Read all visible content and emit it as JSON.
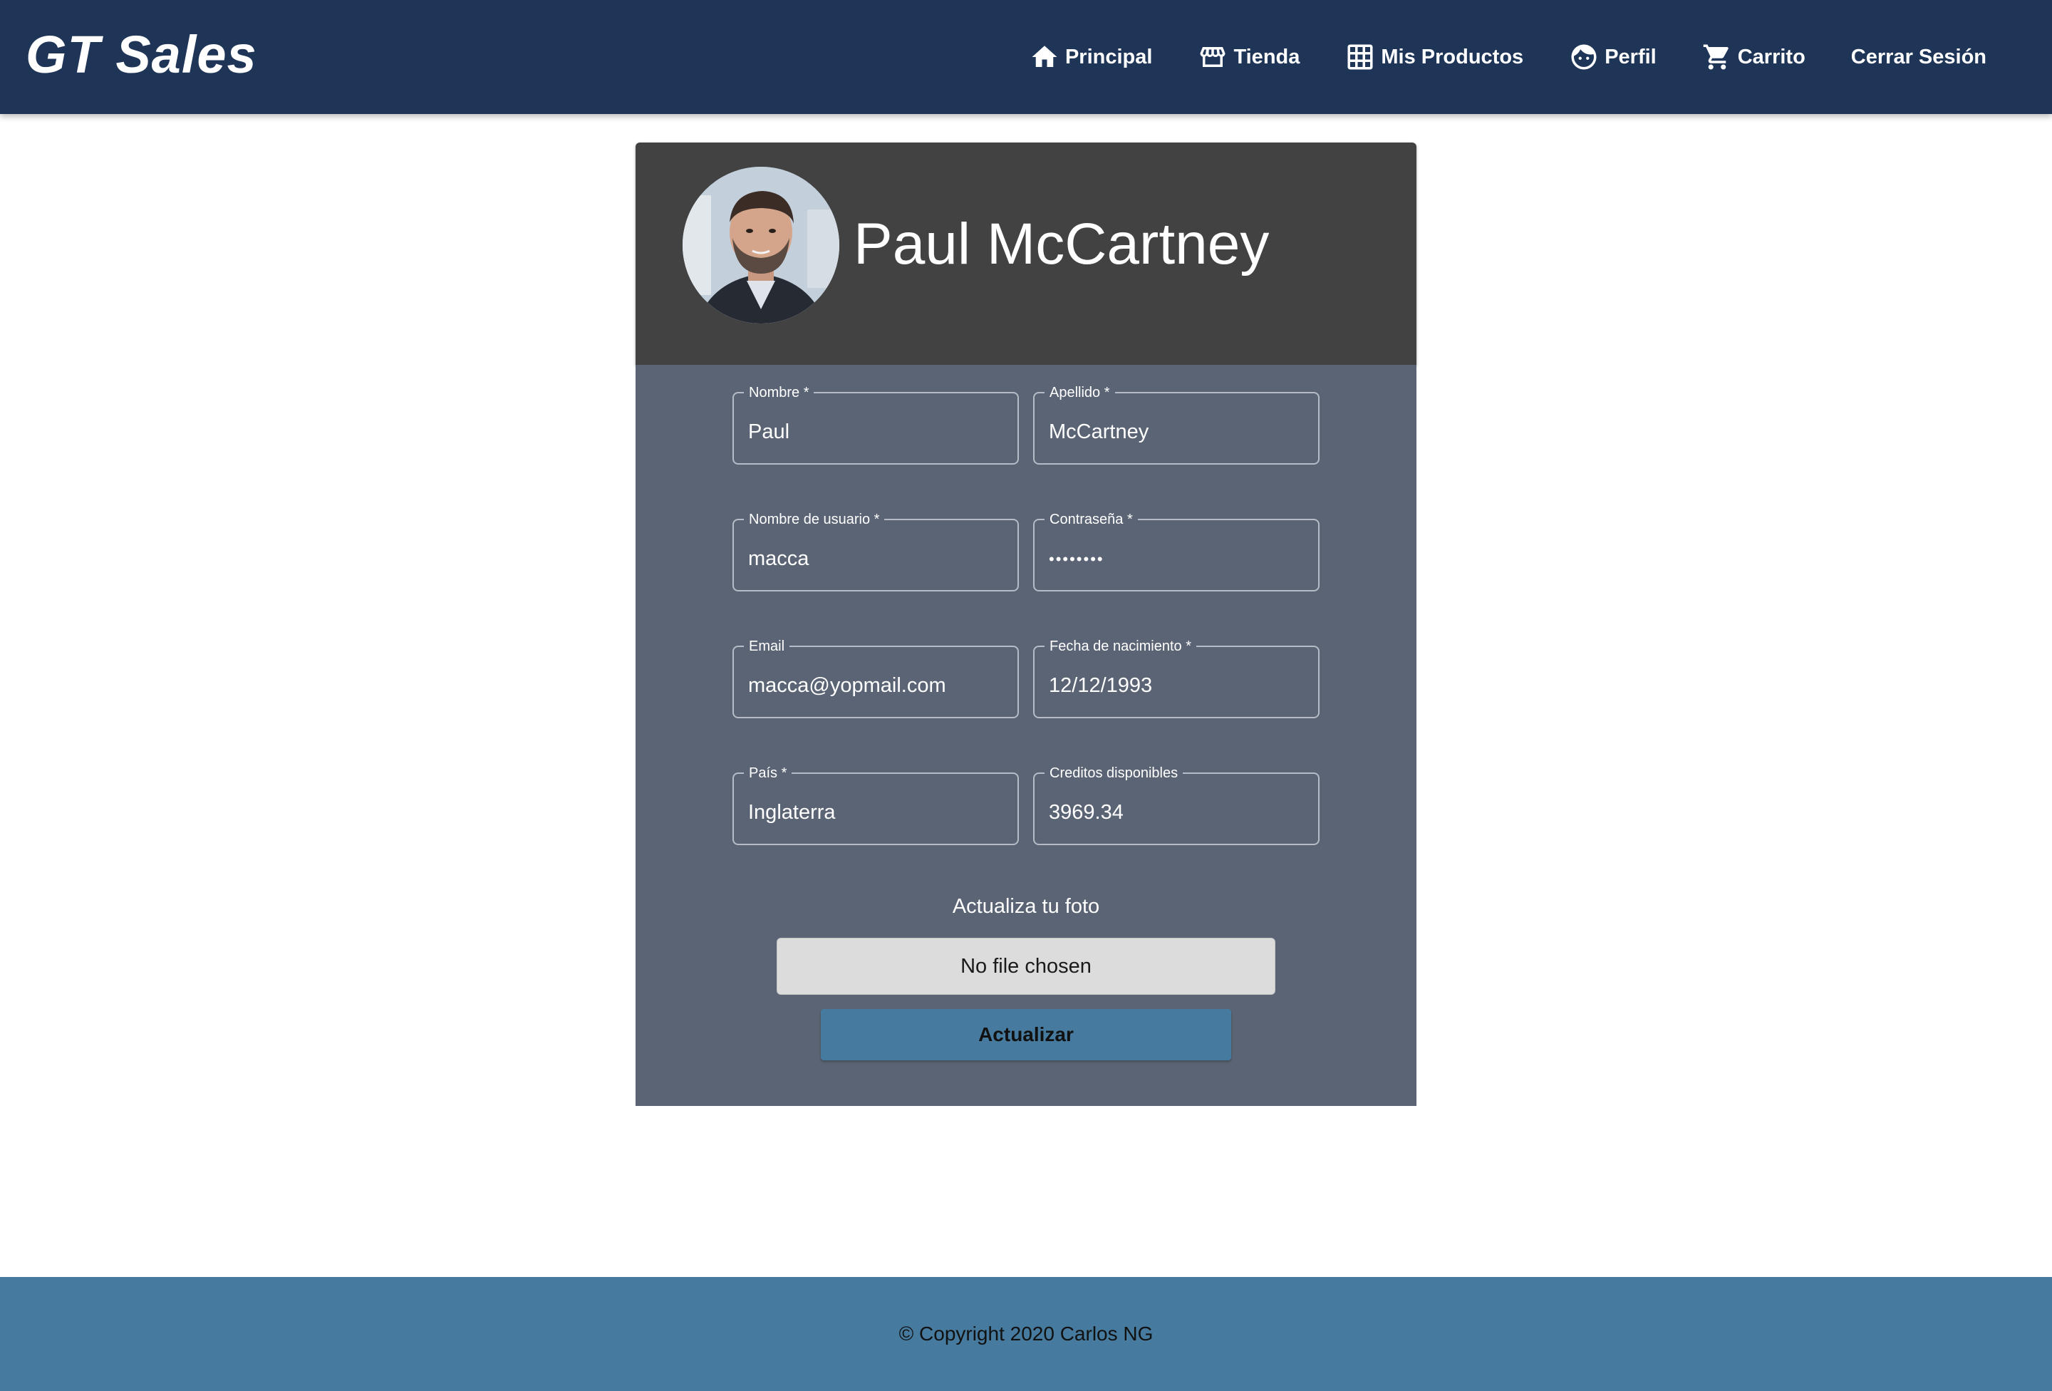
{
  "header": {
    "brand": "GT Sales",
    "nav": [
      {
        "label": "Principal",
        "icon": "home-icon"
      },
      {
        "label": "Tienda",
        "icon": "store-icon"
      },
      {
        "label": "Mis Productos",
        "icon": "grid-icon"
      },
      {
        "label": "Perfil",
        "icon": "face-icon"
      },
      {
        "label": "Carrito",
        "icon": "cart-icon"
      },
      {
        "label": "Cerrar Sesión",
        "icon": ""
      }
    ]
  },
  "profile": {
    "name": "Paul McCartney",
    "avatar_icon": "user-photo"
  },
  "form": {
    "nombre": {
      "label": "Nombre *",
      "value": "Paul"
    },
    "apellido": {
      "label": "Apellido *",
      "value": "McCartney"
    },
    "usuario": {
      "label": "Nombre de usuario *",
      "value": "macca"
    },
    "contrasena": {
      "label": "Contraseña *",
      "value": "••••••••"
    },
    "email": {
      "label": "Email",
      "value": "macca@yopmail.com"
    },
    "fecha": {
      "label": "Fecha de nacimiento *",
      "value": "12/12/1993"
    },
    "pais": {
      "label": "País *",
      "value": "Inglaterra"
    },
    "creditos": {
      "label": "Creditos disponibles",
      "value": "3969.34"
    },
    "photo_label": "Actualiza tu foto",
    "file_text": "No file chosen",
    "submit_label": "Actualizar"
  },
  "footer": {
    "text": "© Copyright 2020 Carlos NG"
  },
  "colors": {
    "appbar": "#1f3558",
    "card_header": "#424242",
    "card_body": "#5b6474",
    "accent": "#467a9e"
  }
}
